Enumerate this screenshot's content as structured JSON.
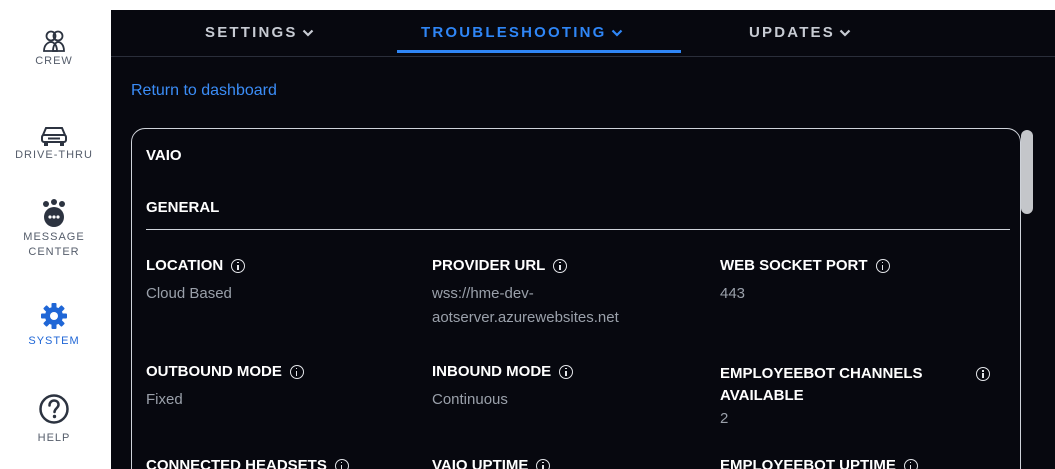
{
  "sidebar": {
    "items": [
      {
        "label": "CREW",
        "icon": "crew-icon"
      },
      {
        "label": "DRIVE-THRU",
        "icon": "car-icon"
      },
      {
        "label": "MESSAGE CENTER",
        "icon": "message-center-icon"
      },
      {
        "label": "SYSTEM",
        "icon": "gear-icon",
        "active": true
      },
      {
        "label": "HELP",
        "icon": "help-icon"
      }
    ]
  },
  "tabs": [
    {
      "label": "SETTINGS"
    },
    {
      "label": "TROUBLESHOOTING",
      "active": true
    },
    {
      "label": "UPDATES"
    }
  ],
  "return_link": "Return to dashboard",
  "card": {
    "title": "VAIO",
    "section": "GENERAL",
    "fields": [
      {
        "label": "LOCATION",
        "value": "Cloud Based"
      },
      {
        "label": "PROVIDER URL",
        "value": "wss://hme-dev-aotserver.azurewebsites.net"
      },
      {
        "label": "WEB SOCKET PORT",
        "value": "443"
      },
      {
        "label": "OUTBOUND MODE",
        "value": "Fixed"
      },
      {
        "label": "INBOUND MODE",
        "value": "Continuous"
      },
      {
        "label": "EMPLOYEEBOT CHANNELS AVAILABLE",
        "value": "2"
      },
      {
        "label": "CONNECTED HEADSETS",
        "value": ""
      },
      {
        "label": "VAIO UPTIME",
        "value": ""
      },
      {
        "label": "EMPLOYEEBOT UPTIME",
        "value": ""
      }
    ]
  },
  "colors": {
    "accent": "#2f86f6",
    "background": "#07080f",
    "sidebar_active": "#1f66d6"
  }
}
